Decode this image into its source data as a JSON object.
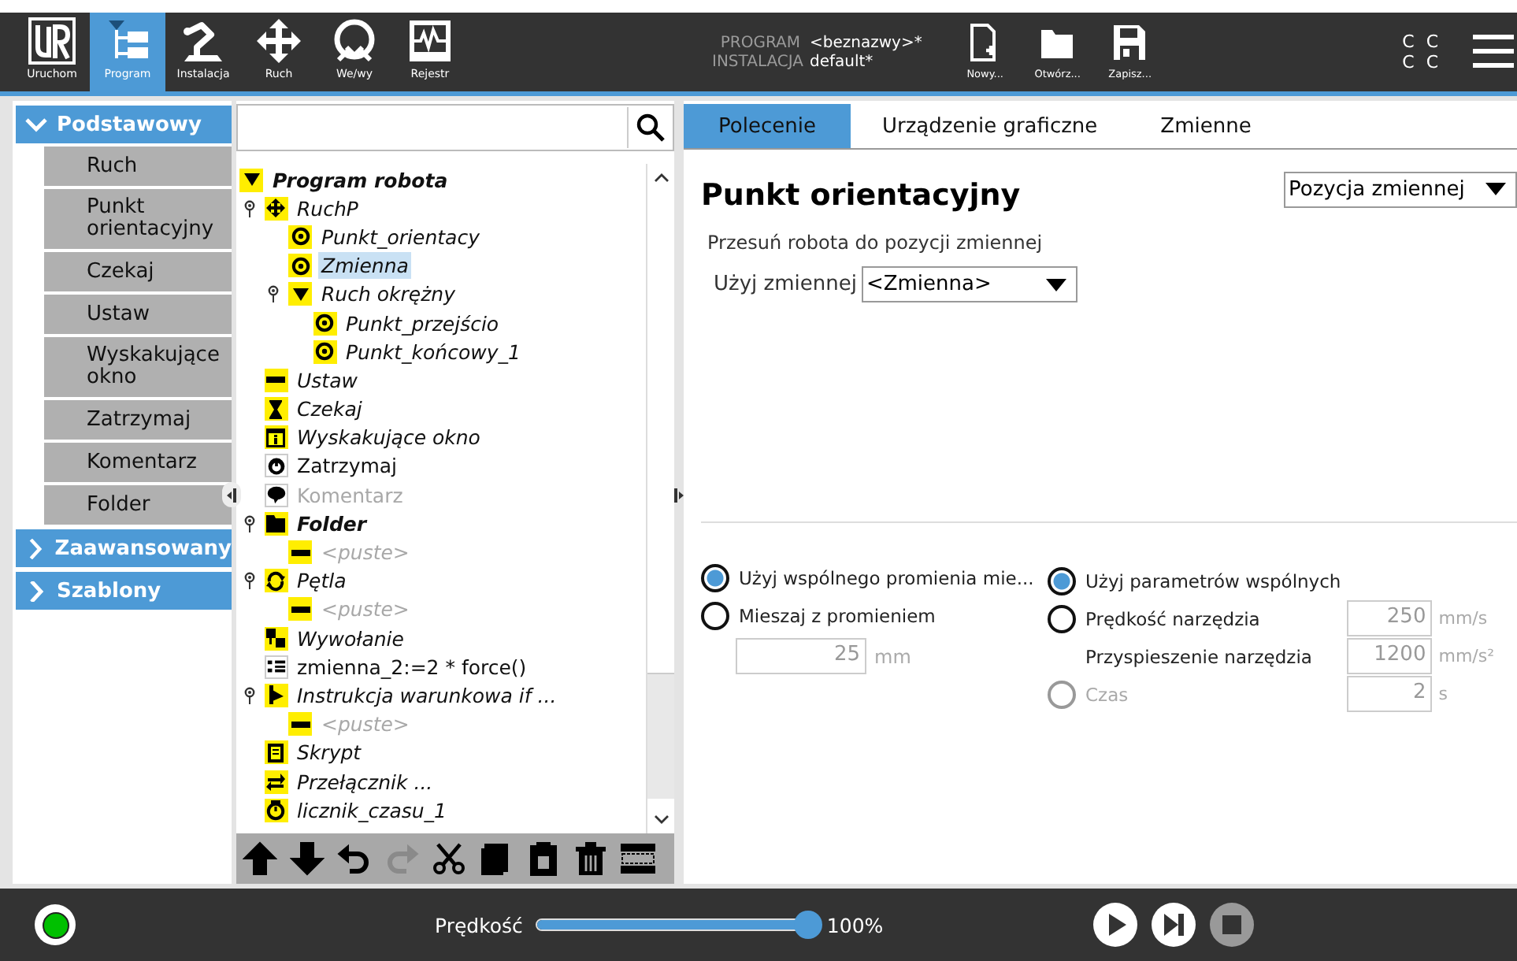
{
  "top_nav": {
    "tabs": [
      {
        "label": "Uruchom",
        "kind": "logo",
        "selected": false
      },
      {
        "label": "Program",
        "kind": "program",
        "selected": true
      },
      {
        "label": "Instalacja",
        "kind": "installation",
        "selected": false
      },
      {
        "label": "Ruch",
        "kind": "move",
        "selected": false
      },
      {
        "label": "We/wy",
        "kind": "io",
        "selected": false
      },
      {
        "label": "Rejestr",
        "kind": "log",
        "selected": false
      }
    ],
    "program_label": "PROGRAM",
    "program_name": "<beznazwy>*",
    "installation_label": "INSTALACJA",
    "installation_name": "default*",
    "file_buttons": [
      {
        "label": "Nowy...",
        "kind": "new"
      },
      {
        "label": "Otwórz...",
        "kind": "open"
      },
      {
        "label": "Zapisz...",
        "kind": "save"
      }
    ],
    "status_lines": [
      "C C",
      "C C"
    ]
  },
  "sidebar": {
    "categories": [
      {
        "label": "Podstawowy",
        "expanded": true,
        "items": [
          {
            "label": "Ruch"
          },
          {
            "label": "Punkt orientacyjny"
          },
          {
            "label": "Czekaj"
          },
          {
            "label": "Ustaw"
          },
          {
            "label": "Wyskakujące okno"
          },
          {
            "label": "Zatrzymaj"
          },
          {
            "label": "Komentarz"
          },
          {
            "label": "Folder"
          }
        ]
      },
      {
        "label": "Zaawansowany",
        "expanded": false
      },
      {
        "label": "Szablony",
        "expanded": false
      }
    ]
  },
  "tree": {
    "nodes": [
      {
        "label": "Program robota",
        "kind": "program",
        "selected": false,
        "children": [
          {
            "label": "RuchP",
            "kind": "move",
            "selected": false,
            "expanded": true,
            "children": [
              {
                "label": "Punkt_orientacy",
                "kind": "waypoint",
                "selected": false
              },
              {
                "label": "Zmienna",
                "kind": "waypoint",
                "selected": true
              },
              {
                "label": "Ruch okrężny",
                "kind": "circular",
                "selected": false,
                "expanded": true,
                "children": [
                  {
                    "label": "Punkt_przejścio",
                    "kind": "waypoint",
                    "selected": false
                  },
                  {
                    "label": "Punkt_końcowy_1",
                    "kind": "waypoint",
                    "selected": false
                  }
                ]
              }
            ]
          },
          {
            "label": "Ustaw",
            "kind": "set",
            "selected": false
          },
          {
            "label": "Czekaj",
            "kind": "wait",
            "selected": false
          },
          {
            "label": "Wyskakujące okno",
            "kind": "popup",
            "selected": false
          },
          {
            "label": "Zatrzymaj",
            "kind": "halt",
            "selected": false
          },
          {
            "label": "Komentarz",
            "kind": "comment",
            "selected": false
          },
          {
            "label": "Folder",
            "kind": "folder",
            "selected": false,
            "expanded": true,
            "children": [
              {
                "label": "<puste>",
                "kind": "empty",
                "selected": false
              }
            ]
          },
          {
            "label": "Pętla",
            "kind": "loop",
            "selected": false,
            "expanded": true,
            "children": [
              {
                "label": "<puste>",
                "kind": "empty",
                "selected": false
              }
            ]
          },
          {
            "label": "Wywołanie",
            "kind": "call",
            "selected": false
          },
          {
            "label": "zmienna_2:=2 * force()",
            "kind": "assign",
            "selected": false
          },
          {
            "label": "Instrukcja warunkowa if ...",
            "kind": "if",
            "selected": false,
            "expanded": true,
            "children": [
              {
                "label": "<puste>",
                "kind": "empty",
                "selected": false
              }
            ]
          },
          {
            "label": "Skrypt",
            "kind": "script",
            "selected": false
          },
          {
            "label": "Przełącznik ...",
            "kind": "switch",
            "selected": false
          },
          {
            "label": "licznik_czasu_1",
            "kind": "timer",
            "selected": false
          }
        ]
      }
    ]
  },
  "toolbar": [
    {
      "kind": "up",
      "disabled": false
    },
    {
      "kind": "down",
      "disabled": false
    },
    {
      "kind": "undo",
      "disabled": false
    },
    {
      "kind": "redo",
      "disabled": true
    },
    {
      "kind": "cut",
      "disabled": false
    },
    {
      "kind": "copy",
      "disabled": false
    },
    {
      "kind": "paste",
      "disabled": false
    },
    {
      "kind": "delete",
      "disabled": false
    },
    {
      "kind": "suppress",
      "disabled": false
    }
  ],
  "command_panel": {
    "tabs": [
      {
        "label": "Polecenie",
        "selected": true
      },
      {
        "label": "Urządzenie graficzne",
        "selected": false
      },
      {
        "label": "Zmienne",
        "selected": false
      }
    ],
    "title": "Punkt orientacyjny",
    "type_dropdown": "Pozycja zmiennej",
    "description": "Przesuń robota do pozycji zmiennej",
    "variable_label": "Użyj zmiennej",
    "variable_dropdown": "<Zmienna>",
    "blend_options": [
      {
        "label": "Użyj wspólnego promienia mie...",
        "selected": true
      },
      {
        "label": "Mieszaj z promieniem",
        "selected": false
      }
    ],
    "blend_radius": {
      "value": "25",
      "unit": "mm",
      "disabled": true
    },
    "speed_options": [
      {
        "kind": "radio",
        "label": "Użyj parametrów wspólnych",
        "selected": true,
        "disabled": false
      },
      {
        "kind": "radio",
        "label": "Prędkość narzędzia",
        "selected": false,
        "disabled": false,
        "value": "250",
        "unit": "mm/s",
        "field_disabled": true
      },
      {
        "kind": "field",
        "label": "Przyspieszenie narzędzia",
        "value": "1200",
        "unit": "mm/s²",
        "field_disabled": true
      },
      {
        "kind": "radio",
        "label": "Czas",
        "selected": false,
        "disabled": true,
        "value": "2",
        "unit": "s",
        "field_disabled": true
      }
    ]
  },
  "bottom_bar": {
    "power": {
      "on": true
    },
    "speed_label": "Prędkość",
    "speed": {
      "level": 1.0
    },
    "speed_reading": "100%",
    "controls": [
      {
        "kind": "play",
        "disabled": false
      },
      {
        "kind": "step",
        "disabled": false
      },
      {
        "kind": "stop",
        "disabled": true
      }
    ]
  }
}
